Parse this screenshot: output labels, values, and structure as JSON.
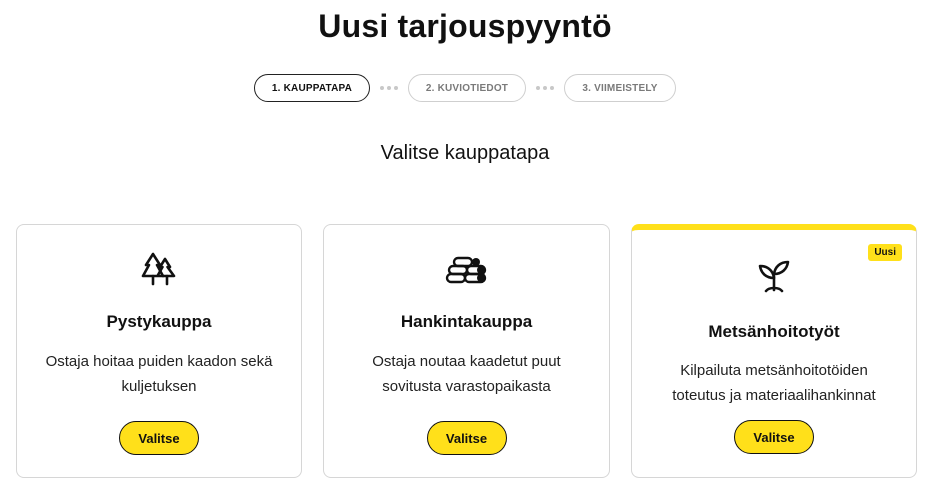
{
  "page": {
    "title": "Uusi tarjouspyyntö",
    "subtitle": "Valitse kauppatapa"
  },
  "steps": [
    {
      "label": "1. KAUPPATAPA",
      "active": true
    },
    {
      "label": "2. KUVIOTIEDOT",
      "active": false
    },
    {
      "label": "3. VIIMEISTELY",
      "active": false
    }
  ],
  "cards": [
    {
      "icon": "forest-icon",
      "title": "Pystykauppa",
      "description": "Ostaja hoitaa puiden kaadon sekä kuljetuksen",
      "button": "Valitse"
    },
    {
      "icon": "log-pile-icon",
      "title": "Hankintakauppa",
      "description": "Ostaja noutaa kaadetut puut sovitusta varastopaikasta",
      "button": "Valitse"
    },
    {
      "icon": "sprout-icon",
      "title": "Metsänhoitotyöt",
      "description": "Kilpailuta metsänhoitotöiden toteutus ja materiaalihankinnat",
      "button": "Valitse",
      "badge": "Uusi"
    }
  ],
  "colors": {
    "accent": "#ffe01a",
    "text": "#111111",
    "border": "#d6d6d6",
    "muted": "#7a7a7a"
  }
}
